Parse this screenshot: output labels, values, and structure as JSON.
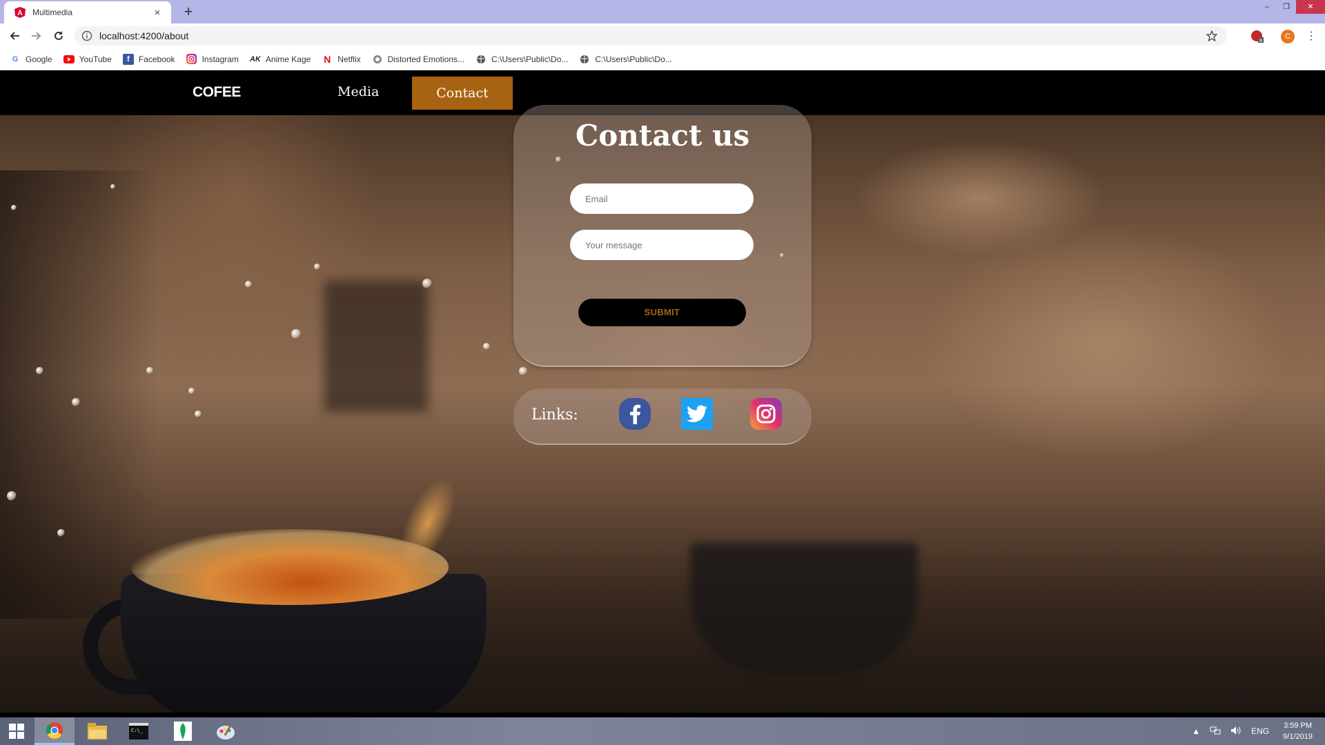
{
  "browser": {
    "tab_title": "Multimedia",
    "tab_close": "×",
    "new_tab": "+",
    "url": "localhost:4200/about",
    "profile_initial": "C",
    "window_controls": {
      "minimize": "–",
      "restore": "❐",
      "close": "✕"
    },
    "bookmarks": [
      {
        "label": "Google",
        "icon": "google-icon"
      },
      {
        "label": "YouTube",
        "icon": "youtube-icon"
      },
      {
        "label": "Facebook",
        "icon": "facebook-icon"
      },
      {
        "label": "Instagram",
        "icon": "instagram-icon"
      },
      {
        "label": "Anime Kage",
        "icon": "anime-kage-icon"
      },
      {
        "label": "Netflix",
        "icon": "netflix-icon"
      },
      {
        "label": "Distorted Emotions...",
        "icon": "globe-icon"
      },
      {
        "label": "C:\\Users\\Public\\Do...",
        "icon": "globe-icon"
      },
      {
        "label": "C:\\Users\\Public\\Do...",
        "icon": "globe-icon"
      }
    ]
  },
  "site": {
    "brand": "COFEE",
    "nav": {
      "media": "Media",
      "contact": "Contact"
    },
    "accent_color": "#a86312",
    "contact": {
      "title": "Contact us",
      "email_placeholder": "Email",
      "message_placeholder": "Your message",
      "submit_label": "SUBMIT"
    },
    "links": {
      "label": "Links:",
      "social": [
        "facebook-icon",
        "twitter-icon",
        "instagram-icon"
      ]
    }
  },
  "taskbar": {
    "language": "ENG",
    "time": "3:59 PM",
    "date": "9/1/2019",
    "apps": [
      "chrome-icon",
      "file-explorer-icon",
      "terminal-icon",
      "mongodb-compass-icon",
      "paint-icon"
    ]
  }
}
